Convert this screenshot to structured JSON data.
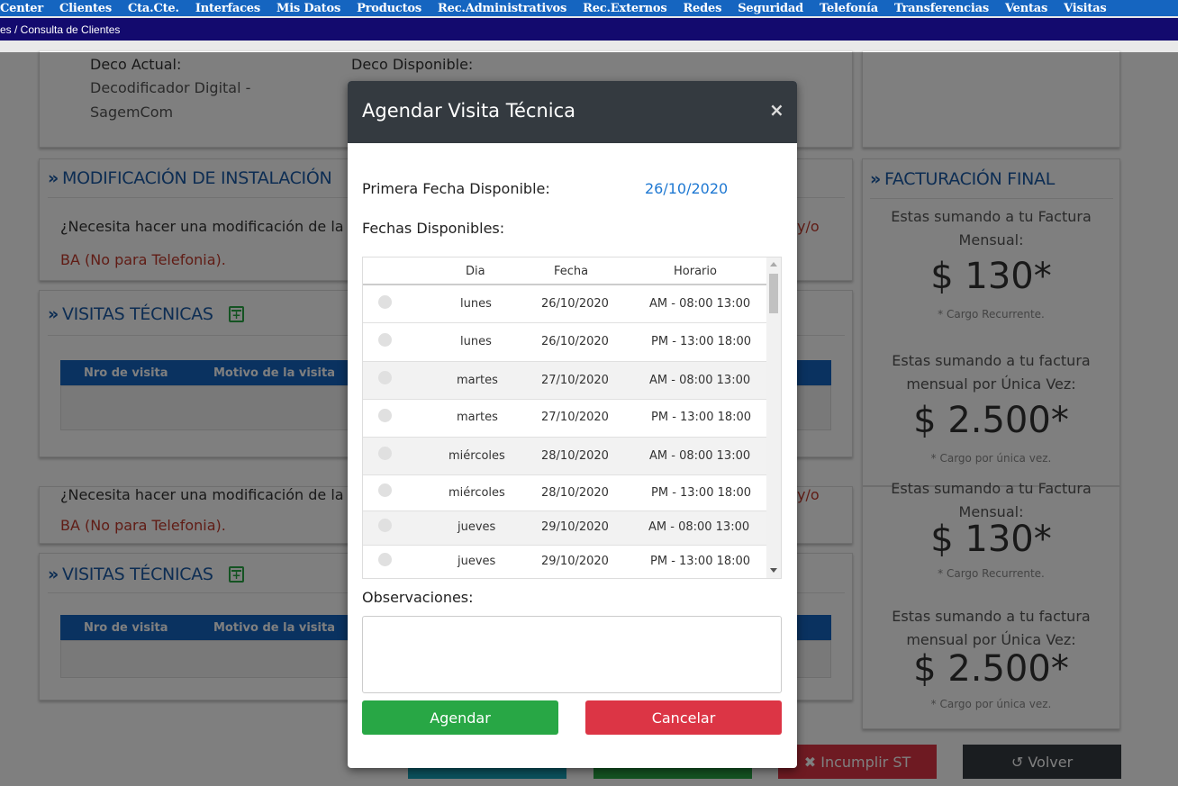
{
  "nav": {
    "items": [
      "Center",
      "Clientes",
      "Cta.Cte.",
      "Interfaces",
      "Mis Datos",
      "Productos",
      "Rec.Administrativos",
      "Rec.Externos",
      "Redes",
      "Seguridad",
      "Telefonía",
      "Transferencias",
      "Ventas",
      "Visitas"
    ]
  },
  "breadcrumb": "es / Consulta de Clientes",
  "deco": {
    "actual_label": "Deco Actual:",
    "actual_value_1": "Decodificador Digital -",
    "actual_value_2": "SagemCom",
    "disponible_label": "Deco Disponible:"
  },
  "modificacion": {
    "title": "MODIFICACIÓN DE INSTALACIÓN",
    "question": "¿Necesita hacer una modificación de la",
    "suffix": "y/o",
    "note": "BA (No para Telefonia)."
  },
  "visitas": {
    "title": "VISITAS TÉCNICAS",
    "col_nro": "Nro de visita",
    "col_motivo": "Motivo de la visita"
  },
  "facturacion": {
    "title": "FACTURACIÓN FINAL",
    "monthly_label_1": "Estas sumando a tu Factura",
    "monthly_label_2": "Mensual:",
    "monthly_price": "$ 130*",
    "monthly_note": "* Cargo Recurrente.",
    "once_label_1": "Estas sumando a tu factura",
    "once_label_2": "mensual por Única Vez:",
    "once_price": "$ 2.500*",
    "once_note": "* Cargo por única vez."
  },
  "bottom_buttons": {
    "incumplir": "✖ Incumplir ST",
    "volver": "↺ Volver"
  },
  "modal": {
    "title": "Agendar Visita Técnica",
    "close": "×",
    "primera_label": "Primera Fecha Disponible:",
    "primera_value": "26/10/2020",
    "fechas_label": "Fechas Disponibles:",
    "columns": {
      "dia": "Dia",
      "fecha": "Fecha",
      "horario": "Horario"
    },
    "rows": [
      {
        "dia": "lunes",
        "fecha": "26/10/2020",
        "horario": "AM - 08:00 13:00"
      },
      {
        "dia": "lunes",
        "fecha": "26/10/2020",
        "horario": "PM - 13:00 18:00"
      },
      {
        "dia": "martes",
        "fecha": "27/10/2020",
        "horario": "AM - 08:00 13:00"
      },
      {
        "dia": "martes",
        "fecha": "27/10/2020",
        "horario": "PM - 13:00 18:00"
      },
      {
        "dia": "miércoles",
        "fecha": "28/10/2020",
        "horario": "AM - 08:00 13:00"
      },
      {
        "dia": "miércoles",
        "fecha": "28/10/2020",
        "horario": "PM - 13:00 18:00"
      },
      {
        "dia": "jueves",
        "fecha": "29/10/2020",
        "horario": "AM - 08:00 13:00"
      },
      {
        "dia": "jueves",
        "fecha": "29/10/2020",
        "horario": "PM - 13:00 18:00"
      }
    ],
    "observaciones_label": "Observaciones:",
    "observaciones_value": "",
    "agendar": "Agendar",
    "cancelar": "Cancelar"
  },
  "colors": {
    "nav_bg": "#1565c0",
    "breadcrumb_bg": "#130a6e",
    "modal_header": "#343a40",
    "agendar": "#28a745",
    "cancelar": "#dc3545",
    "date_accent": "#1e78d2"
  }
}
